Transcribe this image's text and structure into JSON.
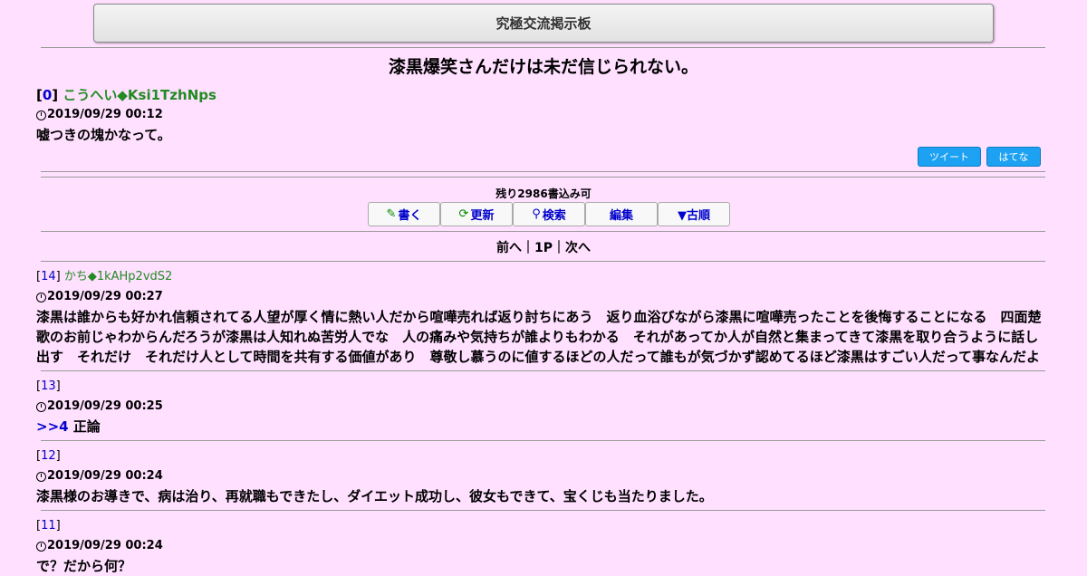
{
  "board": {
    "title": "究極交流掲示板"
  },
  "thread": {
    "title": "漆黒爆笑さんだけは未だ信じられない。"
  },
  "op": {
    "num": "0",
    "name": "こうへい◆Ksi1TzhNps",
    "date": "2019/09/29 00:12",
    "body": "嘘つきの塊かなって。"
  },
  "share": {
    "tweet": "ツイート",
    "hatena": "はてな"
  },
  "remaining": "残り2986書込み可",
  "actions": [
    {
      "icon": "✎",
      "label": "書く"
    },
    {
      "icon": "⟳",
      "label": "更新"
    },
    {
      "icon": "⚲",
      "label": "検索"
    },
    {
      "icon": "",
      "label": "編集"
    },
    {
      "icon": "",
      "label": "▼古順"
    }
  ],
  "pager": {
    "prev": "前へ",
    "page": "1P",
    "next": "次へ",
    "sep": "｜"
  },
  "posts": [
    {
      "num": "14",
      "name": "かち◆1kAHp2vdS2",
      "date": "2019/09/29 00:27",
      "anchor": "",
      "body": "漆黒は誰からも好かれ信頼されてる人望が厚く情に熱い人だから喧嘩売れば返り討ちにあう　返り血浴びながら漆黒に喧嘩売ったことを後悔することになる　四面楚歌のお前じゃわからんだろうが漆黒は人知れぬ苦労人でな　人の痛みや気持ちが誰よりもわかる　それがあってか人が自然と集まってきて漆黒を取り合うように話し出す　それだけ　それだけ人として時間を共有する価値があり　尊敬し慕うのに値するほどの人だって誰もが気づかず認めてるほど漆黒はすごい人だって事なんだよ"
    },
    {
      "num": "13",
      "name": "",
      "date": "2019/09/29 00:25",
      "anchor": ">>4",
      "body": " 正論"
    },
    {
      "num": "12",
      "name": "",
      "date": "2019/09/29 00:24",
      "anchor": "",
      "body": "漆黒様のお導きで、病は治り、再就職もできたし、ダイエット成功し、彼女もできて、宝くじも当たりました。"
    },
    {
      "num": "11",
      "name": "",
      "date": "2019/09/29 00:24",
      "anchor": "",
      "body": "で？だから何？"
    }
  ]
}
